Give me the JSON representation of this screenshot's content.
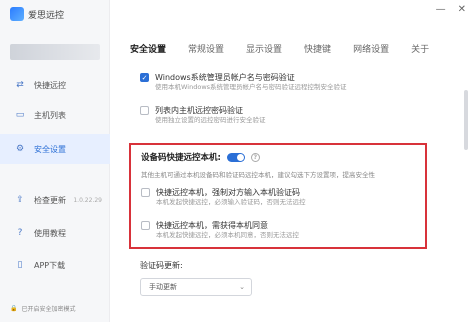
{
  "app": {
    "name": "爱思远控"
  },
  "window_controls": {
    "minimize": "—",
    "close": "✕"
  },
  "sidebar": {
    "items": [
      {
        "label": "快捷远控",
        "icon": "remote-icon",
        "badge": ""
      },
      {
        "label": "主机列表",
        "icon": "host-list-icon",
        "badge": ""
      },
      {
        "label": "安全设置",
        "icon": "shield-gear-icon",
        "badge": ""
      },
      {
        "label": "检查更新",
        "icon": "update-icon",
        "badge": "1.0.22.29"
      },
      {
        "label": "使用教程",
        "icon": "tutorial-icon",
        "badge": ""
      },
      {
        "label": "APP下载",
        "icon": "download-icon",
        "badge": ""
      }
    ],
    "footer": "已开启安全加密模式"
  },
  "tabs": [
    {
      "label": "安全设置",
      "active": true
    },
    {
      "label": "常规设置",
      "active": false
    },
    {
      "label": "显示设置",
      "active": false
    },
    {
      "label": "快捷键",
      "active": false
    },
    {
      "label": "网络设置",
      "active": false
    },
    {
      "label": "关于",
      "active": false
    }
  ],
  "options_top": [
    {
      "label": "Windows系统管理员帐户名与密码验证",
      "desc": "使用本机Windows系统管理员帐户名与密码验证远程控制安全验证",
      "checked": true
    },
    {
      "label": "列表内主机远控密码验证",
      "desc": "使用独立设置的远控密码进行安全验证",
      "checked": false
    }
  ],
  "device_code_section": {
    "title": "设备码快捷远控本机:",
    "toggle_on": true,
    "description": "其他主机可通过本机设备码和验证码远控本机，建议勾选下方设置项，提高安全性",
    "options": [
      {
        "label": "快捷远控本机，强制对方输入本机验证码",
        "desc": "本机发起快捷远控，必须输入验证码，否则无法远控",
        "checked": false
      },
      {
        "label": "快捷远控本机，需获得本机同意",
        "desc": "本机发起快捷远控，必须本机同意，否则无法远控",
        "checked": false
      }
    ]
  },
  "verification_update": {
    "label": "验证码更新:",
    "selected": "手动更新"
  },
  "colors": {
    "accent": "#2b6fd6",
    "highlight_border": "#d8323a"
  }
}
